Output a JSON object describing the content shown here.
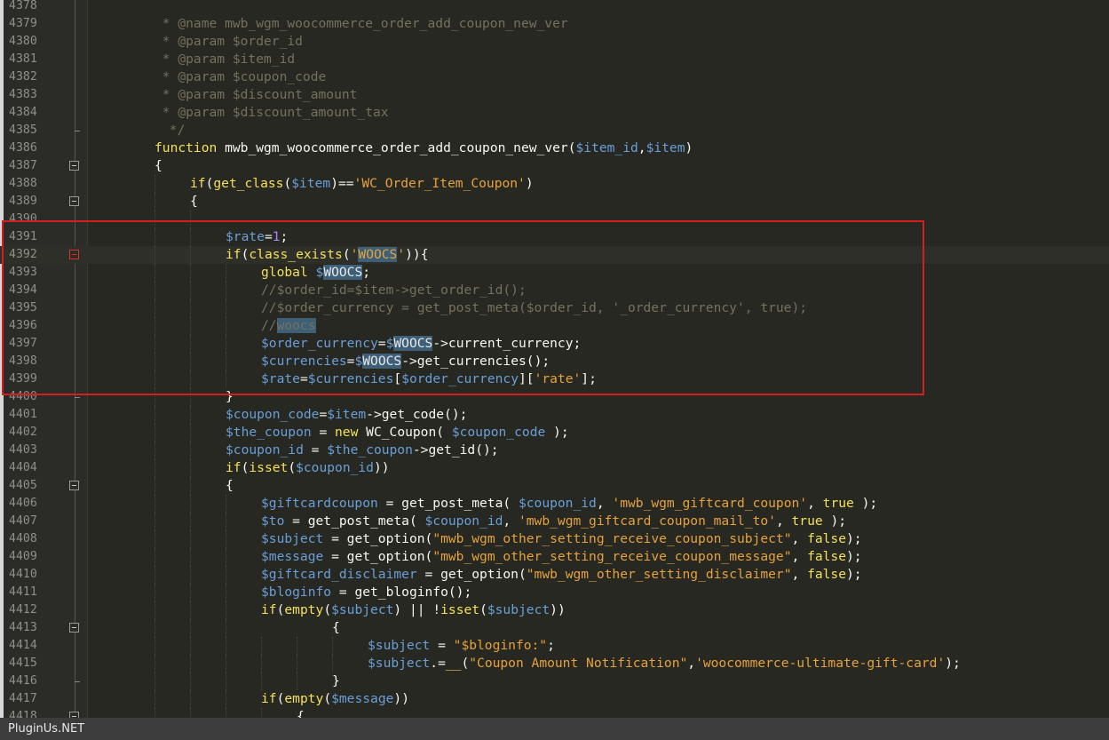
{
  "editor": {
    "lines": [
      {
        "number": "4378",
        "text": ""
      },
      {
        "number": "4379",
        "text": " * @name mwb_wgm_woocommerce_order_add_coupon_new_ver"
      },
      {
        "number": "4380",
        "text": " * @param $order_id"
      },
      {
        "number": "4381",
        "text": " * @param $item_id"
      },
      {
        "number": "4382",
        "text": " * @param $coupon_code"
      },
      {
        "number": "4383",
        "text": " * @param $discount_amount"
      },
      {
        "number": "4384",
        "text": " * @param $discount_amount_tax"
      },
      {
        "number": "4385",
        "text": " */"
      },
      {
        "number": "4386",
        "text": "function mwb_wgm_woocommerce_order_add_coupon_new_ver($item_id,$item)"
      },
      {
        "number": "4387",
        "text": "{"
      },
      {
        "number": "4388",
        "text": "if(get_class($item)=='WC_Order_Item_Coupon')"
      },
      {
        "number": "4389",
        "text": "{"
      },
      {
        "number": "4390",
        "text": ""
      },
      {
        "number": "4391",
        "text": "$rate=1;"
      },
      {
        "number": "4392",
        "text": "if(class_exists('WOOCS')){"
      },
      {
        "number": "4393",
        "text": "global $WOOCS;"
      },
      {
        "number": "4394",
        "text": "//$order_id=$item->get_order_id();"
      },
      {
        "number": "4395",
        "text": "//$order_currency = get_post_meta($order_id, '_order_currency', true);"
      },
      {
        "number": "4396",
        "text": "//woocs"
      },
      {
        "number": "4397",
        "text": "$order_currency=$WOOCS->current_currency;"
      },
      {
        "number": "4398",
        "text": "$currencies=$WOOCS->get_currencies();"
      },
      {
        "number": "4399",
        "text": "$rate=$currencies[$order_currency]['rate'];"
      },
      {
        "number": "4400",
        "text": "}"
      },
      {
        "number": "4401",
        "text": "$coupon_code=$item->get_code();"
      },
      {
        "number": "4402",
        "text": "$the_coupon = new WC_Coupon( $coupon_code );"
      },
      {
        "number": "4403",
        "text": "$coupon_id = $the_coupon->get_id();"
      },
      {
        "number": "4404",
        "text": "if(isset($coupon_id))"
      },
      {
        "number": "4405",
        "text": "{"
      },
      {
        "number": "4406",
        "text": "$giftcardcoupon = get_post_meta( $coupon_id, 'mwb_wgm_giftcard_coupon', true );"
      },
      {
        "number": "4407",
        "text": "$to = get_post_meta( $coupon_id, 'mwb_wgm_giftcard_coupon_mail_to', true );"
      },
      {
        "number": "4408",
        "text": "$subject = get_option(\"mwb_wgm_other_setting_receive_coupon_subject\", false);"
      },
      {
        "number": "4409",
        "text": "$message = get_option(\"mwb_wgm_other_setting_receive_coupon_message\", false);"
      },
      {
        "number": "4410",
        "text": "$giftcard_disclaimer = get_option(\"mwb_wgm_other_setting_disclaimer\", false);"
      },
      {
        "number": "4411",
        "text": "$bloginfo = get_bloginfo();"
      },
      {
        "number": "4412",
        "text": "if(empty($subject) || !isset($subject))"
      },
      {
        "number": "4413",
        "text": "{"
      },
      {
        "number": "4414",
        "text": "$subject = \"$bloginfo:\";"
      },
      {
        "number": "4415",
        "text": "$subject.=__(\"Coupon Amount Notification\",'woocommerce-ultimate-gift-card');"
      },
      {
        "number": "4416",
        "text": "}"
      },
      {
        "number": "4417",
        "text": "if(empty($message))"
      },
      {
        "number": "4418",
        "text": "{"
      }
    ]
  },
  "footer": {
    "brand": "PluginUs.NET"
  },
  "colors": {
    "background": "#272822",
    "keyword": "#f5e05a",
    "string": "#e6a23c",
    "variable": "#6a9fd8",
    "comment": "#75715e",
    "highlight_box": "#d31f1f"
  }
}
